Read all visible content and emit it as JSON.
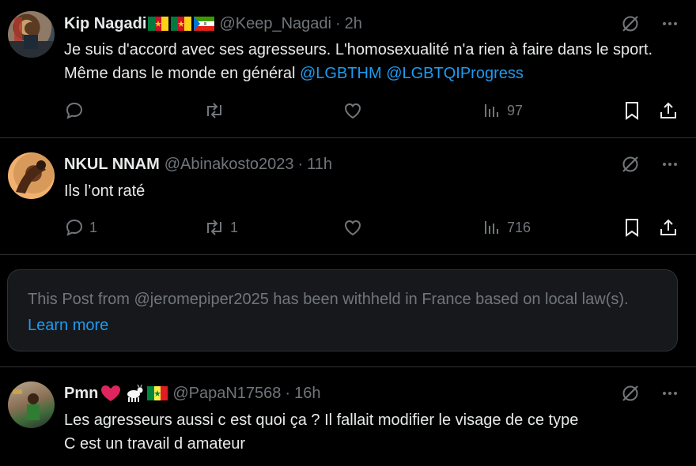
{
  "posts": [
    {
      "name": "Kip Nagadi",
      "handle": "@Keep_Nagadi",
      "sep": "·",
      "time": "2h",
      "text": "Je suis d'accord avec ses agresseurs. L'homosexualité n'a rien à faire dans le sport. Même dans le monde en général ",
      "mentions": [
        "@LGBTHM",
        "@LGBTQIProgress"
      ],
      "replies": "",
      "reposts": "",
      "views": "97"
    },
    {
      "name": "NKUL NNAM",
      "handle": "@Abinakosto2023",
      "sep": "·",
      "time": "11h",
      "text": "Ils l’ont raté",
      "replies": "1",
      "reposts": "1",
      "views": "716"
    },
    {
      "name": "Pmn",
      "handle": "@PapaN17568",
      "sep": "·",
      "time": "16h",
      "text_line1": "Les agresseurs aussi c est quoi ça ? Il fallait modifier le visage de ce type",
      "text_line2": "C est un travail d amateur"
    }
  ],
  "withheld": {
    "message": "This Post from @jeromepiper2025 has been withheld in France based on local law(s). ",
    "link": "Learn more"
  },
  "icons": [
    "grok-icon",
    "more-icon",
    "reply-icon",
    "repost-icon",
    "like-icon",
    "views-icon",
    "bookmark-icon",
    "share-icon"
  ],
  "colors": {
    "background": "#000000",
    "text": "#e7e9ea",
    "muted": "#71767b",
    "accent": "#1d9bf0",
    "card": "#16181c"
  }
}
